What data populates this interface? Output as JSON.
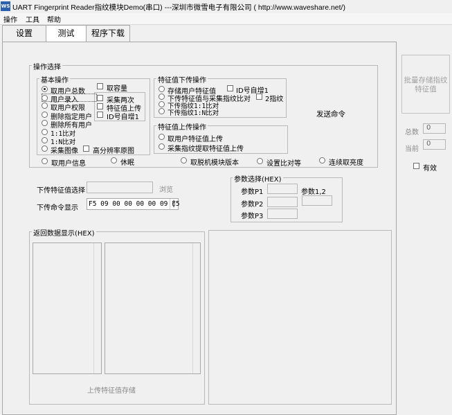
{
  "window": {
    "title": "UART Fingerprint Reader指纹模块Demo(串口)  ---深圳市微雪电子有限公司 ( http://www.waveshare.net/)",
    "icon_text": "WS"
  },
  "menu": [
    "操作",
    "工具",
    "帮助"
  ],
  "tabs": [
    "设置",
    "测试",
    "程序下载"
  ],
  "ops": {
    "title": "操作选择",
    "basic": {
      "title": "基本操作",
      "radios": [
        "取用户总数",
        "用户录入",
        "取用户权限",
        "删除指定用户",
        "删除所有用户",
        "1:1比对",
        "1:N比对",
        "采集图像"
      ],
      "selected": "取用户总数",
      "capacity_check": "取容量",
      "enroll_checks": [
        "采集两次",
        "特征值上传",
        "ID号自增1"
      ],
      "hires_check": "高分辨率原图"
    },
    "download": {
      "title": "特征值下传操作",
      "radios": [
        "存储用户特征值",
        "下传特征值与采集指纹比对",
        "下传指纹1:1比对",
        "下传指纹1:N比对"
      ],
      "id_auto_check": "ID号自增1",
      "two_fp_check": "2指纹"
    },
    "send_label": "发送命令",
    "upload": {
      "title": "特征值上传操作",
      "radios": [
        "取用户特征值上传",
        "采集指纹提取特征值上传"
      ]
    },
    "bottom_radios": [
      "取用户信息",
      "休眠",
      "取脱机模块版本",
      "设置比对等",
      "连续取亮度"
    ]
  },
  "download_select": {
    "label": "下传特征值选择",
    "value": "",
    "browse": "浏览"
  },
  "command_display": {
    "label": "下传命令显示",
    "value": "F5 09 00 00 00 00 09 F5"
  },
  "params": {
    "title": "参数选择(HEX)",
    "p1": {
      "label": "参数P1",
      "value": ""
    },
    "p2": {
      "label": "参数P2",
      "value": ""
    },
    "p3": {
      "label": "参数P3",
      "value": ""
    },
    "p12": {
      "label": "参数1,2",
      "value": ""
    }
  },
  "return": {
    "title": "返回数据显示(HEX)",
    "store_label": "上传特征值存储"
  },
  "right": {
    "batch_button": "批量存储指纹特征值",
    "total": {
      "label": "总数",
      "value": "0"
    },
    "current": {
      "label": "当前",
      "value": "0"
    },
    "valid_check": "有效"
  }
}
